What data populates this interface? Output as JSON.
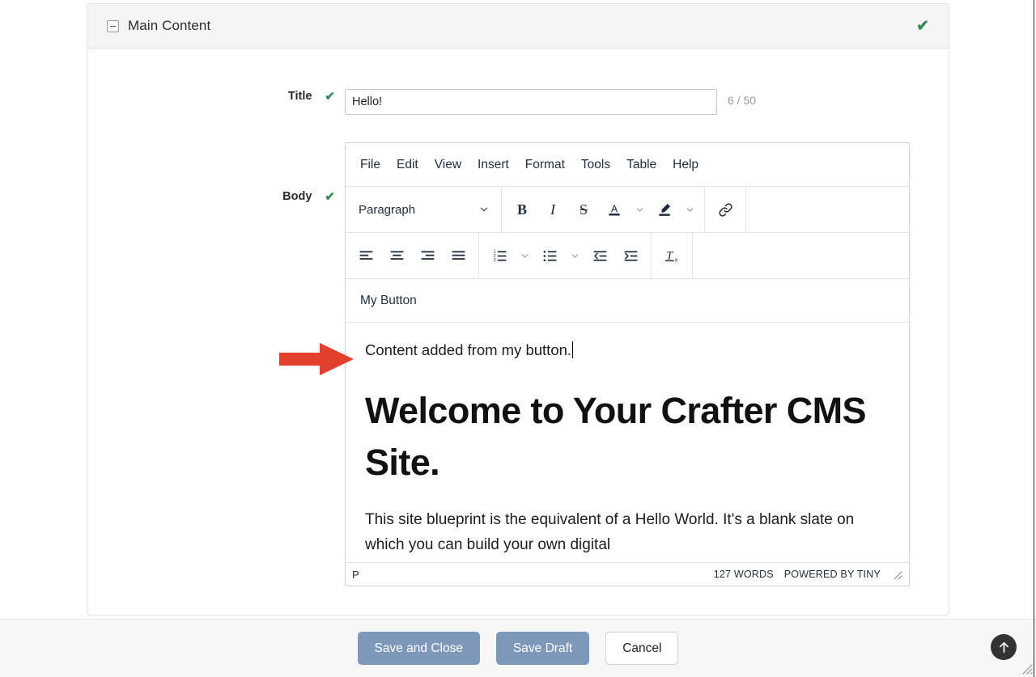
{
  "panel": {
    "title": "Main Content",
    "collapse_icon": "minus-box-icon",
    "valid_check": "✔"
  },
  "fields": {
    "title": {
      "label": "Title",
      "check": "✔",
      "value": "Hello!",
      "placeholder": "",
      "counter": "6 / 50"
    },
    "body": {
      "label": "Body",
      "check": "✔"
    }
  },
  "editor": {
    "menubar": [
      "File",
      "Edit",
      "View",
      "Insert",
      "Format",
      "Tools",
      "Table",
      "Help"
    ],
    "format_select": {
      "value": "Paragraph",
      "chevron": "chevron-down-icon"
    },
    "toolbar_row1": [
      {
        "name": "bold-button",
        "glyph": "B"
      },
      {
        "name": "italic-button",
        "glyph": "I"
      },
      {
        "name": "strikethrough-button",
        "glyph": "S"
      },
      {
        "name": "text-color-button",
        "glyph": "A"
      },
      {
        "name": "text-color-chevron",
        "glyph": "⌄"
      },
      {
        "name": "highlight-color-button",
        "glyph": "pen"
      },
      {
        "name": "highlight-color-chevron",
        "glyph": "⌄"
      },
      {
        "name": "insert-link-button",
        "glyph": "link"
      }
    ],
    "toolbar_row2": [
      {
        "name": "align-left-button"
      },
      {
        "name": "align-center-button"
      },
      {
        "name": "align-right-button"
      },
      {
        "name": "align-justify-button"
      },
      {
        "name": "numbered-list-button"
      },
      {
        "name": "numbered-list-chevron"
      },
      {
        "name": "bulleted-list-button"
      },
      {
        "name": "bulleted-list-chevron"
      },
      {
        "name": "outdent-button"
      },
      {
        "name": "indent-button"
      },
      {
        "name": "clear-formatting-button"
      }
    ],
    "custom_button_label": "My Button",
    "content": {
      "inserted_paragraph": "Content added from my button.",
      "heading": "Welcome to Your Crafter CMS Site.",
      "paragraph": "This site blueprint is the equivalent of a Hello World. It's a blank slate on which you can build your own digital"
    },
    "statusbar": {
      "path": "P",
      "word_count": "127 WORDS",
      "branding": "POWERED BY TINY",
      "resize_handle": "resize-grip-icon"
    }
  },
  "annotation": {
    "arrow_color": "#e2402a",
    "arrow_name": "red-pointer-arrow"
  },
  "footer": {
    "save_and_close": "Save and Close",
    "save_draft": "Save Draft",
    "cancel": "Cancel",
    "scroll_top_icon": "arrow-up-icon",
    "resize_corner_icon": "resize-grip-icon"
  },
  "colors": {
    "primary_button": "#7e98ba",
    "check_green": "#3a8b55",
    "annotation_red": "#e2402a",
    "panel_header_bg": "#f5f5f5",
    "footer_bg": "#f7f7f7"
  }
}
